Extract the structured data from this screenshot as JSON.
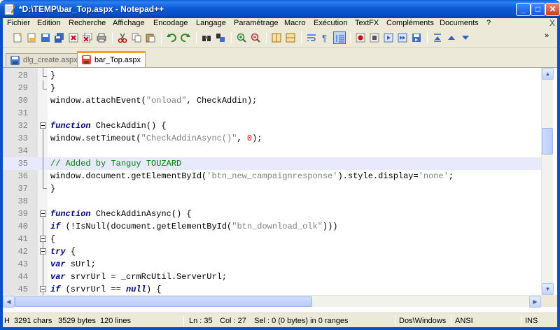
{
  "window": {
    "title": "*D:\\TEMP\\bar_Top.aspx - Notepad++",
    "minimize_label": "_",
    "maximize_label": "□",
    "close_label": "✕"
  },
  "menu": {
    "items": [
      "Fichier",
      "Edition",
      "Recherche",
      "Affichage",
      "Encodage",
      "Langage",
      "Paramétrage",
      "Macro",
      "Exécution",
      "TextFX",
      "Compléments",
      "Documents",
      "?"
    ],
    "close_doc": "X"
  },
  "toolbar": {
    "icons": [
      "new-file-icon",
      "open-file-icon",
      "save-icon",
      "save-all-icon",
      "close-icon",
      "close-all-icon",
      "print-icon",
      "cut-icon",
      "copy-icon",
      "paste-icon",
      "undo-icon",
      "redo-icon",
      "find-icon",
      "replace-icon",
      "zoom-in-icon",
      "zoom-out-icon",
      "sync-v-icon",
      "sync-h-icon",
      "word-wrap-icon",
      "show-all-chars-icon",
      "indent-guide-icon",
      "record-macro-icon",
      "stop-macro-icon",
      "play-macro-icon",
      "run-macro-multiple-icon",
      "save-macro-icon",
      "collapse-icon",
      "up-icon",
      "down-icon"
    ],
    "overflow": "»"
  },
  "tabs": [
    {
      "label": "dlg_create.aspx",
      "active": false
    },
    {
      "label": "bar_Top.aspx",
      "active": true
    }
  ],
  "editor": {
    "current_line": 35,
    "lines": [
      {
        "n": "28",
        "code": "}"
      },
      {
        "n": "29",
        "code": "}"
      },
      {
        "n": "30",
        "code": "window.attachEvent(\"onload\", CheckAddin);"
      },
      {
        "n": "31",
        "code": ""
      },
      {
        "n": "32",
        "code": "function CheckAddin() {"
      },
      {
        "n": "33",
        "code": "window.setTimeout(\"CheckAddinAsync()\", 0);"
      },
      {
        "n": "34",
        "code": ""
      },
      {
        "n": "35",
        "code": "// Added by Tanguy TOUZARD"
      },
      {
        "n": "36",
        "code": "window.document.getElementById('btn_new_campaignresponse').style.display='none';"
      },
      {
        "n": "37",
        "code": "}"
      },
      {
        "n": "38",
        "code": ""
      },
      {
        "n": "39",
        "code": "function CheckAddinAsync() {"
      },
      {
        "n": "40",
        "code": "if (!IsNull(document.getElementById(\"btn_download_olk\")))"
      },
      {
        "n": "41",
        "code": "{"
      },
      {
        "n": "42",
        "code": "try {"
      },
      {
        "n": "43",
        "code": "var sUrl;"
      },
      {
        "n": "44",
        "code": "var srvrUrl = _crmRcUtil.ServerUrl;"
      },
      {
        "n": "45",
        "code": "if (srvrUrl == null) {"
      }
    ]
  },
  "status": {
    "type": "H",
    "chars": "3291 chars",
    "bytes": "3529 bytes",
    "lines": "120 lines",
    "ln": "Ln : 35",
    "col": "Col : 27",
    "sel": "Sel : 0 (0 bytes) in 0 ranges",
    "eol": "Dos\\Windows",
    "encoding": "ANSI",
    "mode": "INS"
  },
  "colors": {
    "keyword": "#00008b",
    "string": "#808080",
    "number": "#ff0000",
    "comment": "#008000",
    "tab_accent": "#f5a020"
  }
}
